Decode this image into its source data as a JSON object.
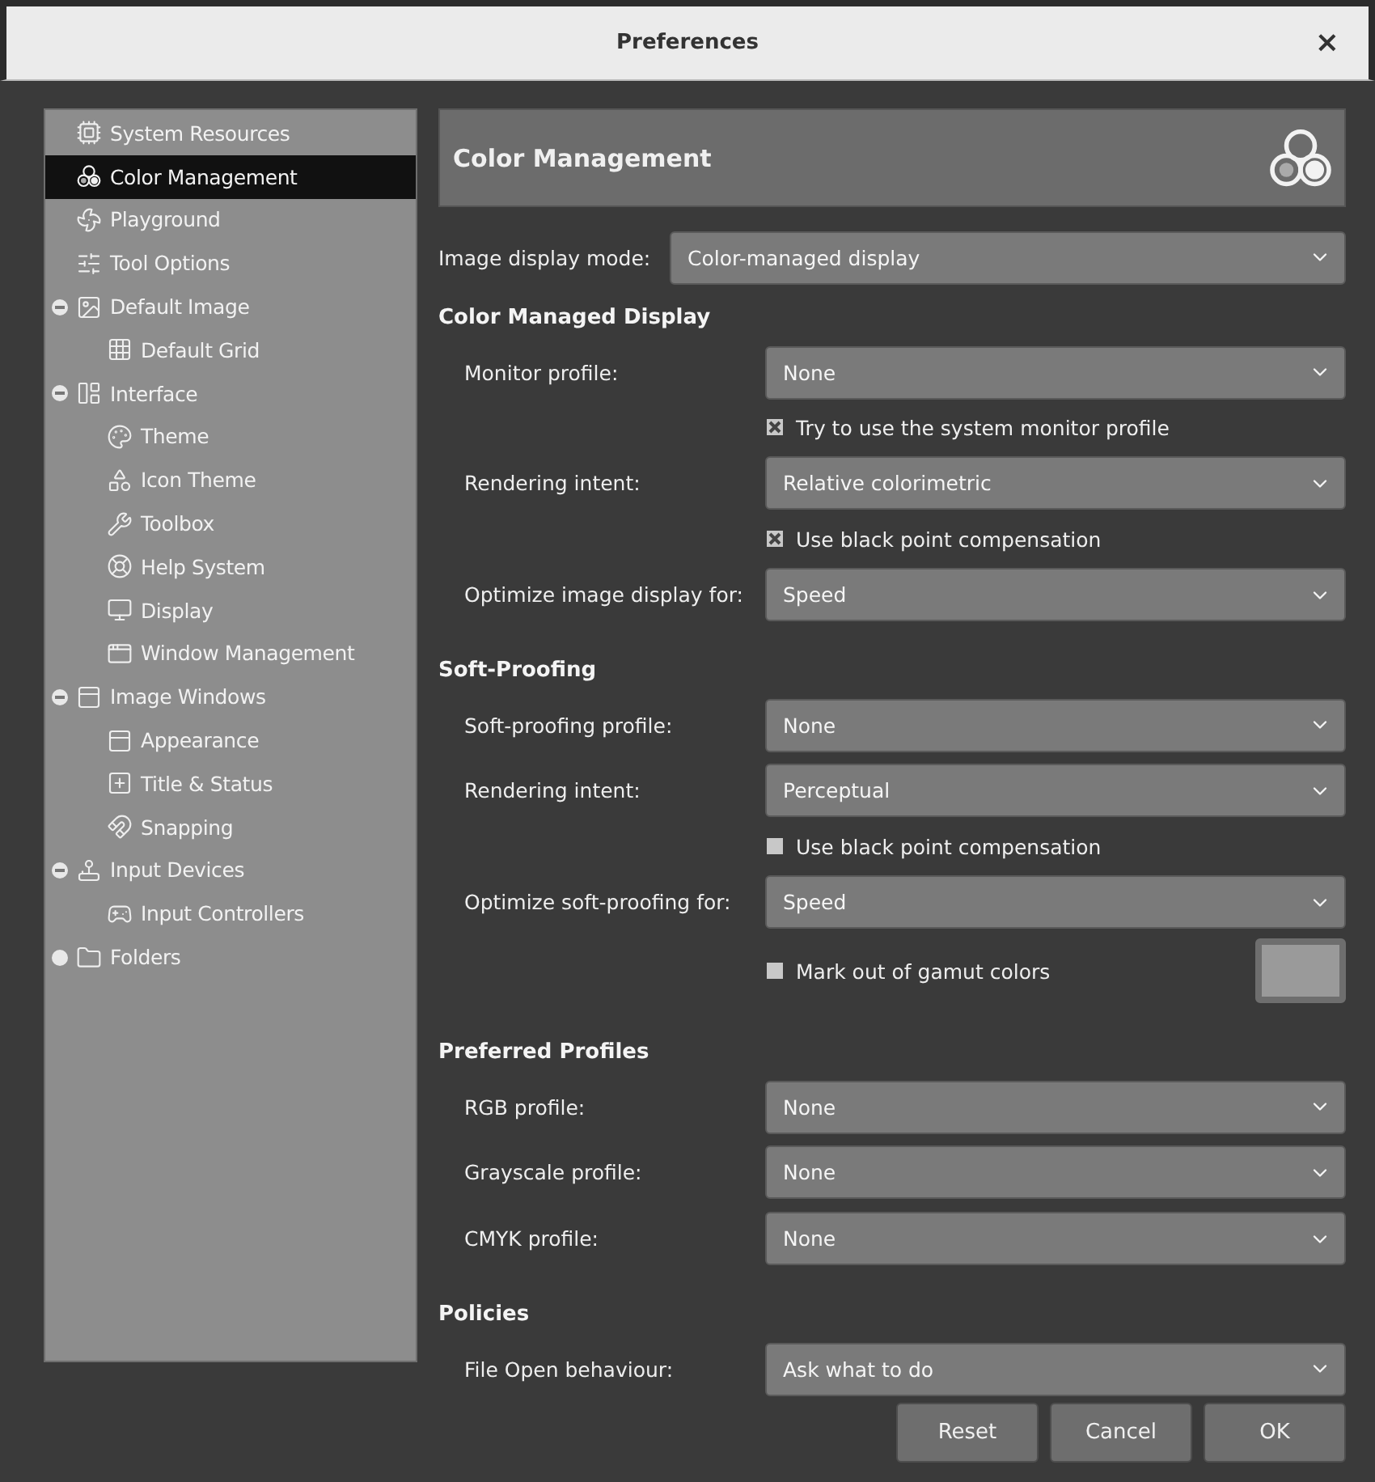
{
  "window": {
    "title": "Preferences",
    "close": "×"
  },
  "sidebar": {
    "items": [
      {
        "label": "System Resources",
        "selected": false
      },
      {
        "label": "Color Management",
        "selected": true
      },
      {
        "label": "Playground",
        "selected": false
      },
      {
        "label": "Tool Options",
        "selected": false
      },
      {
        "label": "Default Image",
        "selected": false,
        "expanded": true,
        "children": [
          {
            "label": "Default Grid",
            "selected": false
          }
        ]
      },
      {
        "label": "Interface",
        "selected": false,
        "expanded": true,
        "children": [
          {
            "label": "Theme",
            "selected": false
          },
          {
            "label": "Icon Theme",
            "selected": false
          },
          {
            "label": "Toolbox",
            "selected": false
          },
          {
            "label": "Help System",
            "selected": false
          },
          {
            "label": "Display",
            "selected": false
          },
          {
            "label": "Window Management",
            "selected": false
          }
        ]
      },
      {
        "label": "Image Windows",
        "selected": false,
        "expanded": true,
        "children": [
          {
            "label": "Appearance",
            "selected": false
          },
          {
            "label": "Title & Status",
            "selected": false
          },
          {
            "label": "Snapping",
            "selected": false
          }
        ]
      },
      {
        "label": "Input Devices",
        "selected": false,
        "expanded": true,
        "children": [
          {
            "label": "Input Controllers",
            "selected": false
          }
        ]
      },
      {
        "label": "Folders",
        "selected": false,
        "expanded": false
      }
    ]
  },
  "page": {
    "title": "Color Management",
    "display_mode": {
      "label": "Image display mode:",
      "value": "Color-managed display"
    },
    "sections": [
      {
        "title": "Color Managed Display",
        "rows": [
          {
            "kind": "dropdown",
            "label": "Monitor profile:",
            "value": "None"
          },
          {
            "kind": "checkbox",
            "label": "Try to use the system monitor profile",
            "checked": true
          },
          {
            "kind": "dropdown",
            "label": "Rendering intent:",
            "value": "Relative colorimetric"
          },
          {
            "kind": "checkbox",
            "label": "Use black point compensation",
            "checked": true
          },
          {
            "kind": "dropdown",
            "label": "Optimize image display for:",
            "value": "Speed"
          }
        ]
      },
      {
        "title": "Soft-Proofing",
        "rows": [
          {
            "kind": "dropdown",
            "label": "Soft-proofing profile:",
            "value": "None"
          },
          {
            "kind": "dropdown",
            "label": "Rendering intent:",
            "value": "Perceptual"
          },
          {
            "kind": "checkbox",
            "label": "Use black point compensation",
            "checked": false
          },
          {
            "kind": "dropdown",
            "label": "Optimize soft-proofing for:",
            "value": "Speed"
          },
          {
            "kind": "checkbox_color",
            "label": "Mark out of gamut colors",
            "checked": false
          }
        ]
      },
      {
        "title": "Preferred Profiles",
        "rows": [
          {
            "kind": "dropdown",
            "label": "RGB profile:",
            "value": "None"
          },
          {
            "kind": "dropdown",
            "label": "Grayscale profile:",
            "value": "None"
          },
          {
            "kind": "dropdown",
            "label": "CMYK profile:",
            "value": "None"
          }
        ]
      },
      {
        "title": "Policies",
        "rows": [
          {
            "kind": "dropdown",
            "label": "File Open behaviour:",
            "value": "Ask what to do"
          }
        ]
      }
    ]
  },
  "buttons": [
    "Reset",
    "Cancel",
    "OK"
  ]
}
